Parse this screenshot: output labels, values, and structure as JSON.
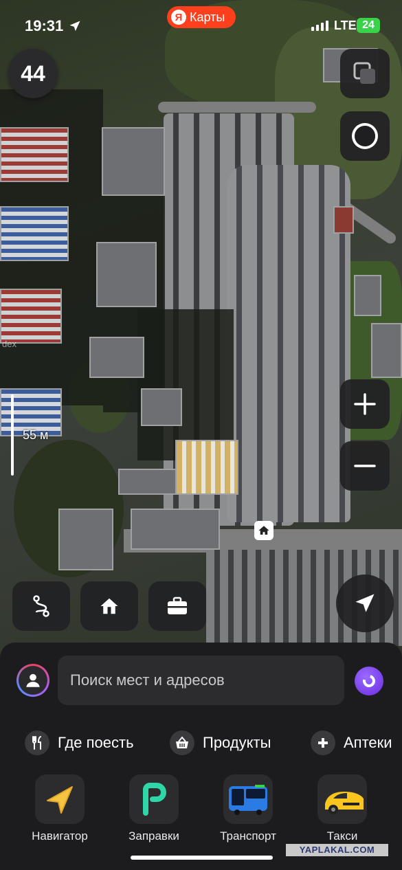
{
  "status_bar": {
    "time": "19:31",
    "network": "LTE",
    "battery": "24"
  },
  "brand": {
    "logo_letter": "Я",
    "name": "Карты"
  },
  "map": {
    "speed": "44",
    "scale_label": "55 м",
    "watermark": "dex",
    "icons": {
      "layers": "layers-icon",
      "theme": "day-night-icon",
      "zoom_in": "plus-icon",
      "zoom_out": "minus-icon",
      "location": "navigation-arrow-icon"
    }
  },
  "shortcuts": [
    {
      "name": "route-shortcut",
      "icon": "route-icon"
    },
    {
      "name": "home-shortcut",
      "icon": "home-icon"
    },
    {
      "name": "work-shortcut",
      "icon": "briefcase-icon"
    }
  ],
  "search": {
    "placeholder": "Поиск мест и адресов"
  },
  "categories": [
    {
      "label": "Где поесть",
      "icon": "fork-knife-icon"
    },
    {
      "label": "Продукты",
      "icon": "basket-icon"
    },
    {
      "label": "Аптеки",
      "icon": "plus-icon"
    }
  ],
  "apps": [
    {
      "label": "Навигатор",
      "icon": "navigator-icon"
    },
    {
      "label": "Заправки",
      "icon": "fuel-icon"
    },
    {
      "label": "Транспорт",
      "icon": "bus-icon"
    },
    {
      "label": "Такси",
      "icon": "taxi-icon"
    }
  ],
  "watermark": "YAPLAKAL.COM",
  "colors": {
    "brand": "#fc3f1d",
    "sheet": "#1c1c1e",
    "alice": "#7a3ff0",
    "battery": "#3ad24a"
  }
}
